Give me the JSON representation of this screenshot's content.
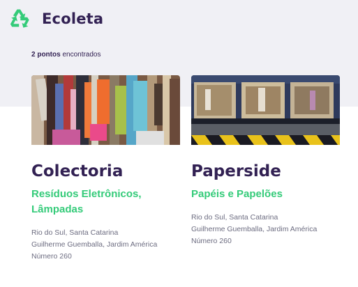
{
  "brand": {
    "name": "Ecoleta",
    "logo_icon": "recycle-icon",
    "accent": "#34cb79"
  },
  "results": {
    "count": "2 pontos",
    "suffix": " encontrados"
  },
  "points": [
    {
      "name": "Colectoria",
      "items_line1": "Resíduos Eletrônicos,",
      "items_line2": "Lâmpadas",
      "city_state": "Rio do Sul, Santa Catarina",
      "street": "Guilherme Guemballa, Jardim América",
      "number": "Número 260",
      "image": "photo-of-electronic-waste"
    },
    {
      "name": "Paperside",
      "items_line1": "Papéis e Papelões",
      "items_line2": "",
      "city_state": "Rio do Sul, Santa Catarina",
      "street": "Guilherme Guemballa, Jardim América",
      "number": "Número 260",
      "image": "photo-of-cardboard-bales"
    }
  ],
  "colors": {
    "title": "#322153",
    "text": "#6c6c80",
    "background_band": "#f0f0f5"
  }
}
